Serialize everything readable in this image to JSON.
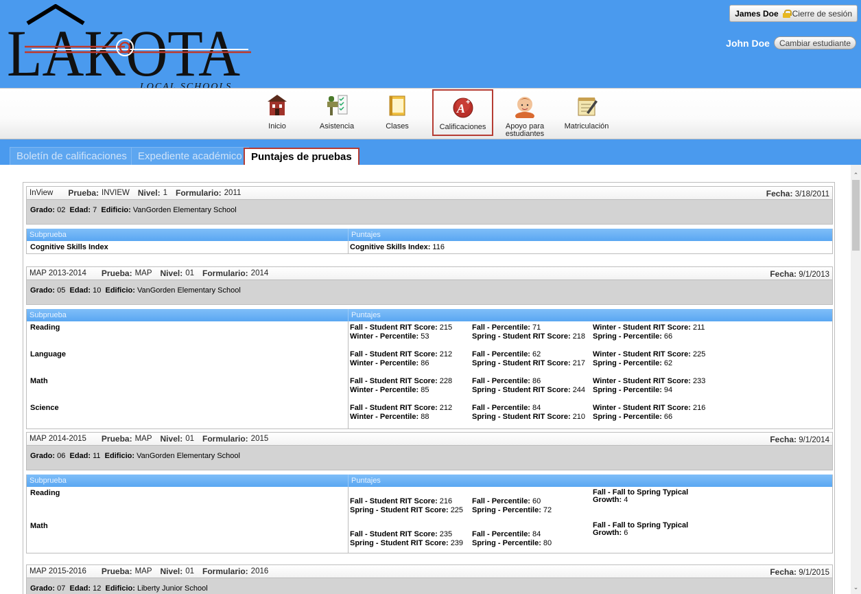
{
  "header": {
    "logo_text": "LAKOTA",
    "logo_subtext": "LOCAL SCHOOLS",
    "user_name": "James Doe",
    "logout_label": "Cierre de sesión",
    "student_name": "John Doe",
    "switch_student_label": "Cambiar estudiante"
  },
  "nav": {
    "items": [
      {
        "label": "Inicio"
      },
      {
        "label": "Asistencia"
      },
      {
        "label": "Clases"
      },
      {
        "label": "Calificaciones"
      },
      {
        "label": "Apoyo para estudiantes"
      },
      {
        "label": "Matriculación"
      }
    ]
  },
  "subtabs": [
    {
      "label": "Boletín de calificaciones"
    },
    {
      "label": "Expediente académico"
    },
    {
      "label": "Puntajes de pruebas"
    }
  ],
  "labels": {
    "prueba": "Prueba:",
    "nivel": "Nivel:",
    "formulario": "Formulario:",
    "fecha": "Fecha:",
    "grado": "Grado:",
    "edad": "Edad:",
    "edificio": "Edificio:",
    "subprueba": "Subprueba",
    "puntajes": "Puntajes"
  },
  "tests": [
    {
      "name": "InView",
      "prueba": "INVIEW",
      "nivel": "1",
      "formulario": "2011",
      "fecha": "3/18/2011",
      "grado": "02",
      "edad": "7",
      "edificio": "VanGorden Elementary School",
      "rows": [
        {
          "subtest": "Cognitive Skills Index",
          "scores": [
            {
              "k": "Cognitive Skills Index:",
              "v": "116"
            }
          ]
        }
      ]
    },
    {
      "name": "MAP 2013-2014",
      "prueba": "MAP",
      "nivel": "01",
      "formulario": "2014",
      "fecha": "9/1/2013",
      "grado": "05",
      "edad": "10",
      "edificio": "VanGorden Elementary School",
      "rows": [
        {
          "subtest": "Reading",
          "scores": [
            {
              "k": "Fall - Student RIT Score:",
              "v": "215"
            },
            {
              "k": "Fall - Percentile:",
              "v": "71"
            },
            {
              "k": "Winter - Student RIT Score:",
              "v": "211"
            },
            {
              "k": "Winter - Percentile:",
              "v": "53"
            },
            {
              "k": "Spring - Student RIT Score:",
              "v": "218"
            },
            {
              "k": "Spring - Percentile:",
              "v": "66"
            }
          ]
        },
        {
          "subtest": "Language",
          "scores": [
            {
              "k": "Fall - Student RIT Score:",
              "v": "212"
            },
            {
              "k": "Fall - Percentile:",
              "v": "62"
            },
            {
              "k": "Winter - Student RIT Score:",
              "v": "225"
            },
            {
              "k": "Winter - Percentile:",
              "v": "86"
            },
            {
              "k": "Spring - Student RIT Score:",
              "v": "217"
            },
            {
              "k": "Spring - Percentile:",
              "v": "62"
            }
          ]
        },
        {
          "subtest": "Math",
          "scores": [
            {
              "k": "Fall - Student RIT Score:",
              "v": "228"
            },
            {
              "k": "Fall - Percentile:",
              "v": "86"
            },
            {
              "k": "Winter - Student RIT Score:",
              "v": "233"
            },
            {
              "k": "Winter - Percentile:",
              "v": "85"
            },
            {
              "k": "Spring - Student RIT Score:",
              "v": "244"
            },
            {
              "k": "Spring - Percentile:",
              "v": "94"
            }
          ]
        },
        {
          "subtest": "Science",
          "scores": [
            {
              "k": "Fall - Student RIT Score:",
              "v": "212"
            },
            {
              "k": "Fall - Percentile:",
              "v": "84"
            },
            {
              "k": "Winter - Student RIT Score:",
              "v": "216"
            },
            {
              "k": "Winter - Percentile:",
              "v": "88"
            },
            {
              "k": "Spring - Student RIT Score:",
              "v": "210"
            },
            {
              "k": "Spring - Percentile:",
              "v": "66"
            }
          ]
        }
      ]
    },
    {
      "name": "MAP 2014-2015",
      "prueba": "MAP",
      "nivel": "01",
      "formulario": "2015",
      "fecha": "9/1/2014",
      "grado": "06",
      "edad": "11",
      "edificio": "VanGorden Elementary School",
      "rows": [
        {
          "subtest": "Reading",
          "scores": [
            {
              "k": "Fall - Student RIT Score:",
              "v": "216"
            },
            {
              "k": "Fall - Percentile:",
              "v": "60"
            },
            {
              "k": "Fall - Fall to Spring Typical Growth:",
              "v": "4"
            },
            {
              "k": "Spring - Student RIT Score:",
              "v": "225"
            },
            {
              "k": "Spring - Percentile:",
              "v": "72"
            }
          ]
        },
        {
          "subtest": "Math",
          "scores": [
            {
              "k": "Fall - Student RIT Score:",
              "v": "235"
            },
            {
              "k": "Fall - Percentile:",
              "v": "84"
            },
            {
              "k": "Fall - Fall to Spring Typical Growth:",
              "v": "6"
            },
            {
              "k": "Spring - Student RIT Score:",
              "v": "239"
            },
            {
              "k": "Spring - Percentile:",
              "v": "80"
            }
          ]
        }
      ]
    },
    {
      "name": "MAP 2015-2016",
      "prueba": "MAP",
      "nivel": "01",
      "formulario": "2016",
      "fecha": "9/1/2015",
      "grado": "07",
      "edad": "12",
      "edificio": "Liberty Junior School",
      "rows": []
    }
  ]
}
